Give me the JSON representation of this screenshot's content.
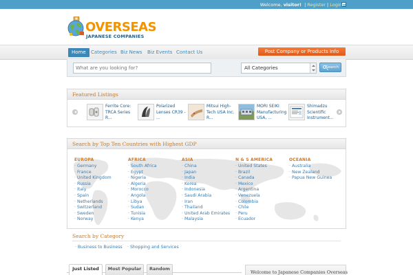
{
  "topbar": {
    "welcome_prefix": "Welcome,",
    "username": "visitor!",
    "register": "Register",
    "login": "Login"
  },
  "logo": {
    "title": "OVERSEAS",
    "subtitle": "JAPANESE COMPANIES"
  },
  "nav": {
    "items": [
      "Home",
      "Categories",
      "Biz News",
      "Biz Events",
      "Contact Us"
    ],
    "active": "Home",
    "post_button": "Post Company or Products Info"
  },
  "search": {
    "placeholder": "What are you looking for?",
    "category_selected": "All Categories",
    "button": "Search"
  },
  "featured": {
    "title": "Featured Listings",
    "items": [
      {
        "text": "Ferrite Core: TRCA Series R..."
      },
      {
        "text": "Polarized Lenses CR39 - ..."
      },
      {
        "text": "Mitsui High-Tech USA Inc. R..."
      },
      {
        "text": "MORI SEIKI Manufacturing USA, ..."
      },
      {
        "text": "Shimadzu Scientific Instrument..."
      }
    ]
  },
  "countries": {
    "title": "Search by Top Ten Countries with Highest GDP",
    "regions": [
      {
        "name": "EUROPA",
        "countries": [
          "Germany",
          "France",
          "United Kingdom",
          "Russia",
          "Italy",
          "Spain",
          "Netherlands",
          "Switzerland",
          "Sweden",
          "Norway"
        ]
      },
      {
        "name": "AFRICA",
        "countries": [
          "South Africa",
          "Egypt",
          "Nigeria",
          "Algeria",
          "Morocco",
          "Angola",
          "Libya",
          "Sudan",
          "Tunisia",
          "Kenya"
        ]
      },
      {
        "name": "ASIA",
        "countries": [
          "China",
          "Japan",
          "India",
          "Korea",
          "Indonesia",
          "Saudi Arabia",
          "Iran",
          "Thailand",
          "United Arab Emirates",
          "Malaysia"
        ]
      },
      {
        "name": "N & S AMERICA",
        "countries": [
          "United States",
          "Brazil",
          "Canada",
          "Mexico",
          "Argentina",
          "Venezuela",
          "Colombia",
          "Chile",
          "Peru",
          "Ecuador"
        ]
      },
      {
        "name": "OCEANIA",
        "countries": [
          "Australia",
          "New Zealand",
          "Papua New Guinea"
        ]
      }
    ]
  },
  "by_category": {
    "title": "Search by Category",
    "links": [
      "Business to Business",
      "Shopping and Services"
    ]
  },
  "tabs": [
    "Just Listed",
    "Most Popular",
    "Random"
  ],
  "tabs_active": "Just Listed",
  "welcome_box": {
    "text": "Welcome to Japanese Companies Overseas"
  },
  "colors": {
    "topbar": "#4ea0c8",
    "accent_orange": "#e9661f",
    "heading": "#c77a2a",
    "link": "#3b7cb0"
  }
}
